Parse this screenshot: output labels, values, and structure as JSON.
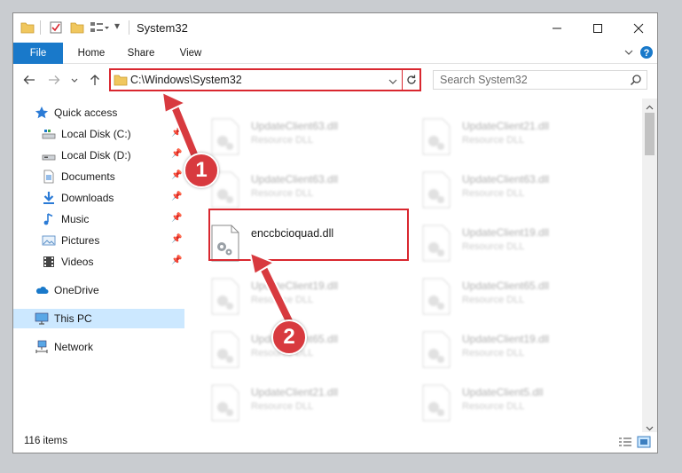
{
  "window": {
    "title": "System32",
    "quick_access_arrow": "▾"
  },
  "ribbon": {
    "tabs": [
      "File",
      "Home",
      "Share",
      "View"
    ]
  },
  "address": {
    "path": "C:\\Windows\\System32",
    "search_placeholder": "Search System32"
  },
  "navigation": {
    "quick_access": "Quick access",
    "pinned": [
      {
        "label": "Local Disk (C:)",
        "icon": "drive-icon"
      },
      {
        "label": "Local Disk (D:)",
        "icon": "drive-icon"
      },
      {
        "label": "Documents",
        "icon": "documents-icon"
      },
      {
        "label": "Downloads",
        "icon": "downloads-icon"
      },
      {
        "label": "Music",
        "icon": "music-icon"
      },
      {
        "label": "Pictures",
        "icon": "pictures-icon"
      },
      {
        "label": "Videos",
        "icon": "videos-icon"
      }
    ],
    "onedrive": "OneDrive",
    "this_pc": "This PC",
    "network": "Network"
  },
  "files": {
    "left_column": [
      {
        "name": "UpdateClient63.dll",
        "type": "Resource DLL"
      },
      {
        "name": "UpdateClient63.dll",
        "type": "Resource DLL"
      },
      {
        "name": "enccbcioquad.dll",
        "type": ""
      },
      {
        "name": "UpdateClient19.dll",
        "type": "Resource DLL"
      },
      {
        "name": "UpdateClient65.dll",
        "type": "Resource DLL"
      },
      {
        "name": "UpdateClient21.dll",
        "type": "Resource DLL"
      }
    ],
    "right_column": [
      {
        "name": "UpdateClient21.dll",
        "type": "Resource DLL"
      },
      {
        "name": "UpdateClient63.dll",
        "type": "Resource DLL"
      },
      {
        "name": "UpdateClient19.dll",
        "type": "Resource DLL"
      },
      {
        "name": "UpdateClient65.dll",
        "type": "Resource DLL"
      },
      {
        "name": "UpdateClient19.dll",
        "type": "Resource DLL"
      },
      {
        "name": "UpdateClient5.dll",
        "type": "Resource DLL"
      }
    ]
  },
  "status": {
    "item_count": "116 items"
  },
  "annotations": {
    "step1": "1",
    "step2": "2",
    "highlight_color": "#d9272f",
    "badge_color": "#d83a3f"
  },
  "colors": {
    "file_tab": "#1979ca",
    "selected_nav": "#cce8ff"
  }
}
